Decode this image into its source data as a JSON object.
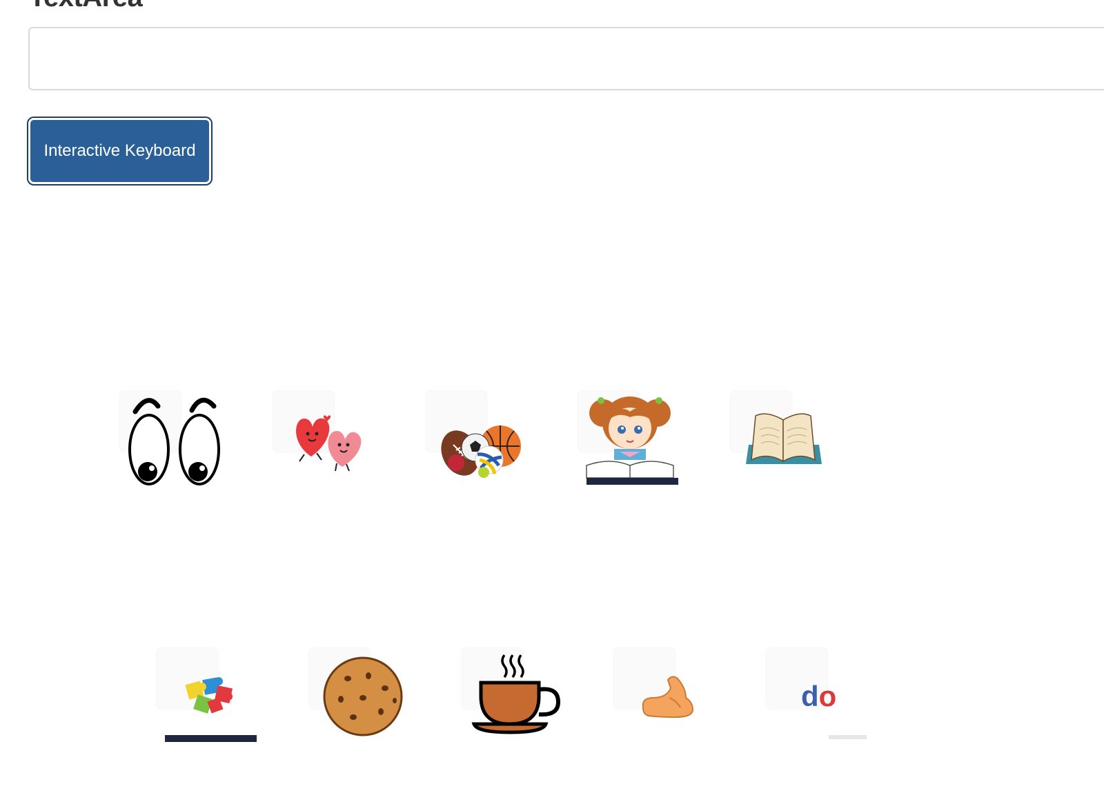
{
  "heading": "TextArea",
  "textarea": {
    "value": "",
    "placeholder": ""
  },
  "keyboard_button": {
    "label": "Interactive Keyboard"
  },
  "symbols_row_1": [
    {
      "name": "eyes",
      "icon": "eyes-icon"
    },
    {
      "name": "hearts",
      "icon": "hearts-icon"
    },
    {
      "name": "sports balls",
      "icon": "sports-balls-icon"
    },
    {
      "name": "girl reading",
      "icon": "girl-reading-icon"
    },
    {
      "name": "open book",
      "icon": "open-book-icon"
    }
  ],
  "symbols_row_2": [
    {
      "name": "puzzle",
      "icon": "puzzle-icon"
    },
    {
      "name": "cookie",
      "icon": "cookie-icon"
    },
    {
      "name": "hot drink",
      "icon": "coffee-cup-icon"
    },
    {
      "name": "muscle",
      "icon": "flexed-arm-icon"
    },
    {
      "name": "do",
      "icon": "do-word-icon",
      "text": "do"
    }
  ],
  "colors": {
    "button_bg": "#2b5f98",
    "heading_text": "#333333",
    "textarea_border": "#d9d9d9"
  }
}
